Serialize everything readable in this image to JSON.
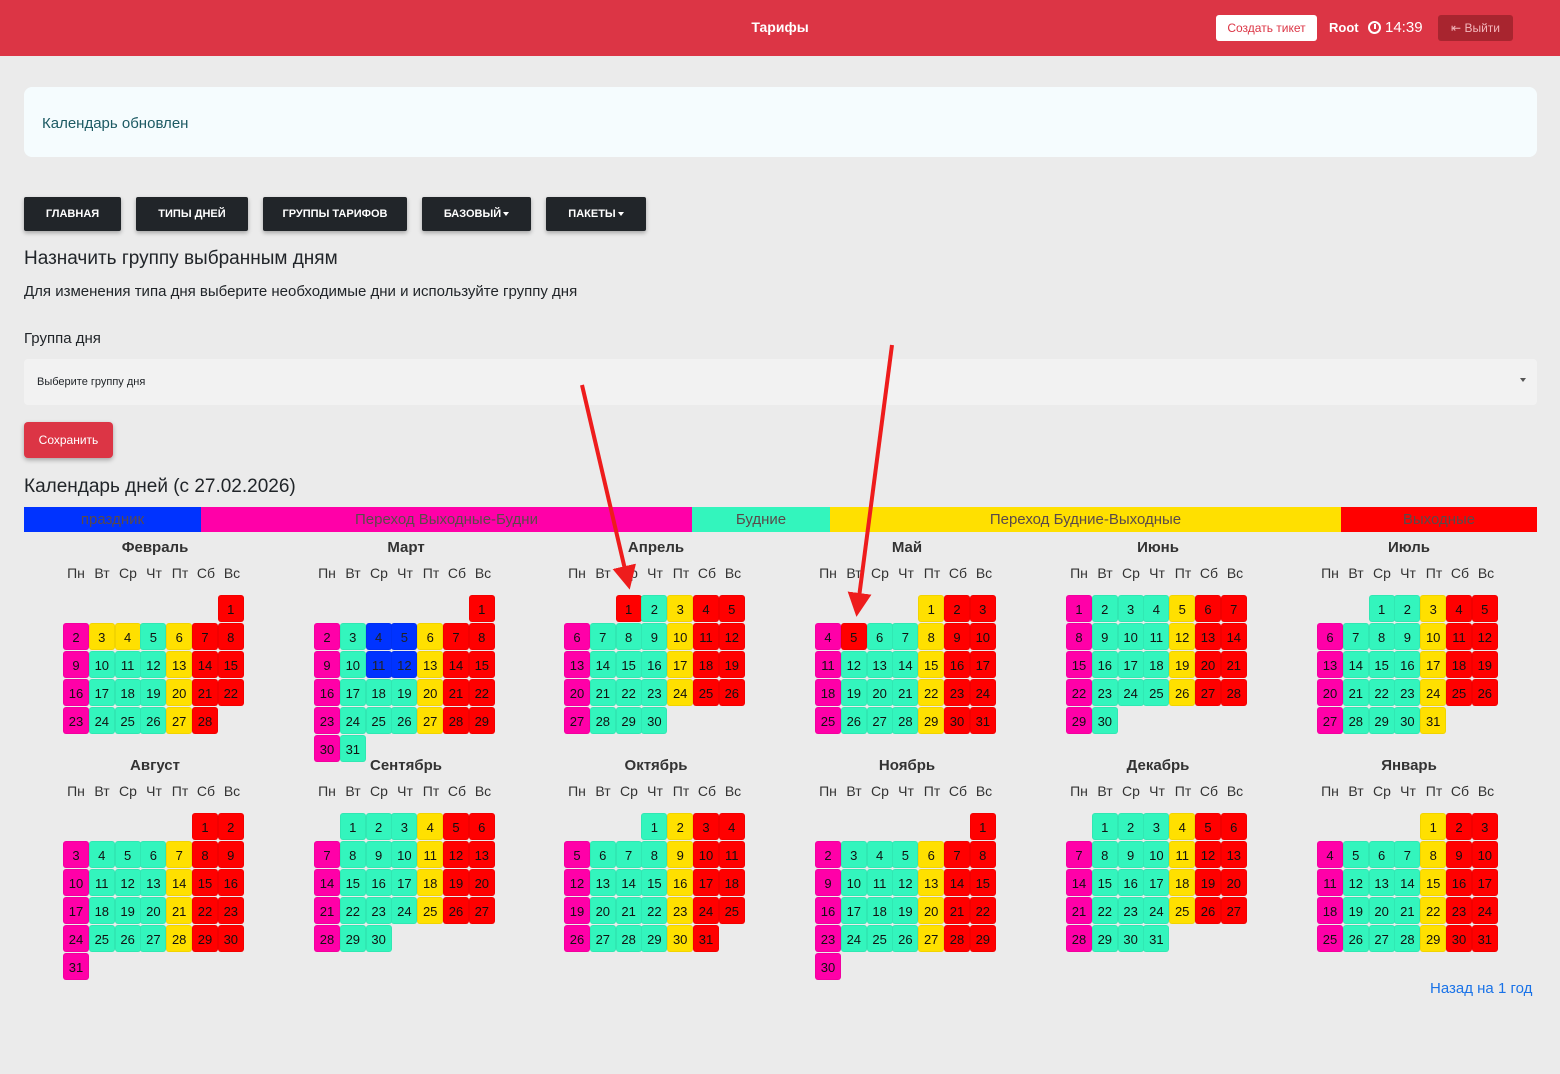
{
  "header": {
    "title": "Тарифы",
    "ticket_button": "Создать тикет",
    "user": "Root",
    "time": "14:39",
    "logout_button": "Выйти"
  },
  "alert": {
    "text": "Календарь обновлен"
  },
  "nav": {
    "home": "ГЛАВНАЯ",
    "day_types": "ТИПЫ ДНЕЙ",
    "tariff_groups": "ГРУППЫ ТАРИФОВ",
    "base": "БАЗОВЫЙ",
    "packages": "ПАКЕТЫ"
  },
  "assign": {
    "title": "Назначить группу выбранным дням",
    "description": "Для изменения типа дня выберите необходимые дни и используйте группу дня",
    "group_label": "Группа дня",
    "select_placeholder": "Выберите группу дня",
    "save_button": "Сохранить"
  },
  "calendar": {
    "title": "Календарь дней (с 27.02.2026)",
    "weekdays": [
      "Пн",
      "Вт",
      "Ср",
      "Чт",
      "Пт",
      "Сб",
      "Вс"
    ],
    "legend": [
      {
        "label": "праздник",
        "color": "#0033ff"
      },
      {
        "label": "Переход Выходные-Будни",
        "color": "#ff00a8"
      },
      {
        "label": "Будние",
        "color": "#33f5bd"
      },
      {
        "label": "Переход Будние-Выходные",
        "color": "#ffe000"
      },
      {
        "label": "Выходные",
        "color": "#ff0000"
      }
    ],
    "colors": {
      "h": "#0033ff",
      "m": "#ff00a8",
      "b": "#33f5bd",
      "y": "#ffe000",
      "r": "#ff0000"
    },
    "months": [
      {
        "name": "Февраль",
        "start": 6,
        "types": "rmyybyrrmbbbyrrmbbbyrrmbbbyr"
      },
      {
        "name": "Март",
        "start": 6,
        "types": "rmbhhyrrmbhhyrrmbbbyrrmbbbyrrmb"
      },
      {
        "name": "Апрель",
        "start": 2,
        "types": "rbyrrmbbbyrrmbbbyrrmbbbyrrmbbb"
      },
      {
        "name": "Май",
        "start": 4,
        "types": "yrrmrbbyrrmbbbyrrmbbbyrrmbbbyrr"
      },
      {
        "name": "Июнь",
        "start": 0,
        "types": "mbbbyrrmbbbyrrmbbbyrrmbbbyrrmb"
      },
      {
        "name": "Июль",
        "start": 2,
        "types": "bbyrrmbbbyrrmbbbyrrmbbbyrrmbbby"
      },
      {
        "name": "Август",
        "start": 5,
        "types": "rrmbbbyrrmbbbyrrmbbbyrrmbbbyrrm"
      },
      {
        "name": "Сентябрь",
        "start": 1,
        "types": "bbbyrrmbbbyrrmbbbyrrmbbbyrrmbb"
      },
      {
        "name": "Октябрь",
        "start": 3,
        "types": "byrrmbbbyrrmbbbyrrmbbbyrrmbbbyr"
      },
      {
        "name": "Ноябрь",
        "start": 6,
        "types": "rmbbbyrrmbbbyrrmbbbyrrmbbbyrrm"
      },
      {
        "name": "Декабрь",
        "start": 1,
        "types": "bbbyrrmbbbyrrmbbbyrrmbbbyrrmbbb"
      },
      {
        "name": "Январь",
        "start": 4,
        "types": "yrrmbbbyrrmbbbyrrmbbbyrrmbbbyrr"
      }
    ],
    "back_link": "Назад на 1 год"
  }
}
